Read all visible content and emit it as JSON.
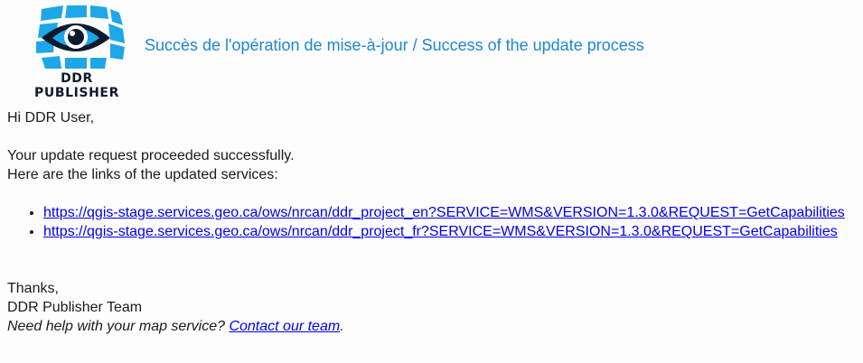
{
  "header": {
    "logo_icon": "ddr-eye-logo-icon",
    "logo_text": "DDR PUBLISHER",
    "title": "Succès de l'opération de mise-à-jour / Success of the update process",
    "title_color": "#1f86d0"
  },
  "body": {
    "greeting": "Hi DDR User,",
    "line1": "Your update request proceeded successfully.",
    "line2": "Here are the links of the updated services:",
    "links": [
      "https://qgis-stage.services.geo.ca/ows/nrcan/ddr_project_en?SERVICE=WMS&VERSION=1.3.0&REQUEST=GetCapabilities",
      "https://qgis-stage.services.geo.ca/ows/nrcan/ddr_project_fr?SERVICE=WMS&VERSION=1.3.0&REQUEST=GetCapabilities"
    ],
    "thanks": "Thanks,",
    "team": "DDR Publisher Team",
    "help_prefix": "Need help with your map service? ",
    "help_link": "Contact our team",
    "help_suffix": "."
  },
  "colors": {
    "link": "#0000ee",
    "logo_blue": "#1ea7e8",
    "logo_dark": "#0e1a2b"
  }
}
